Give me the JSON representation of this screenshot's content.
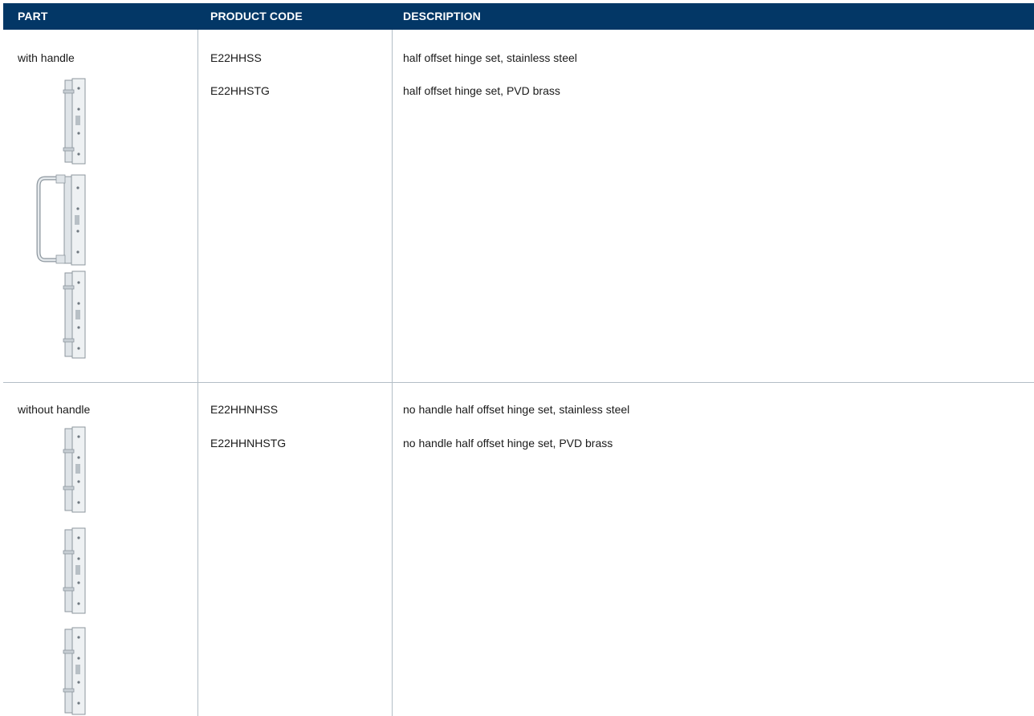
{
  "header": {
    "part": "PART",
    "product_code": "PRODUCT CODE",
    "description": "DESCRIPTION"
  },
  "colors": {
    "header_bg": "#033766",
    "rule": "#b3bec6"
  },
  "rows": [
    {
      "part": "with handle",
      "items": [
        {
          "code": "E22HHSS",
          "description": "half offset hinge set, stainless steel"
        },
        {
          "code": "E22HHSTG",
          "description": "half offset hinge set, PVD brass"
        }
      ],
      "images": [
        "hinge-icon",
        "hinge-with-handle-icon",
        "hinge-icon"
      ]
    },
    {
      "part": "without handle",
      "items": [
        {
          "code": "E22HHNHSS",
          "description": "no handle half offset hinge set, stainless steel"
        },
        {
          "code": "E22HHNHSTG",
          "description": "no handle half offset hinge set, PVD brass"
        }
      ],
      "images": [
        "hinge-icon",
        "hinge-icon",
        "hinge-icon"
      ]
    }
  ]
}
